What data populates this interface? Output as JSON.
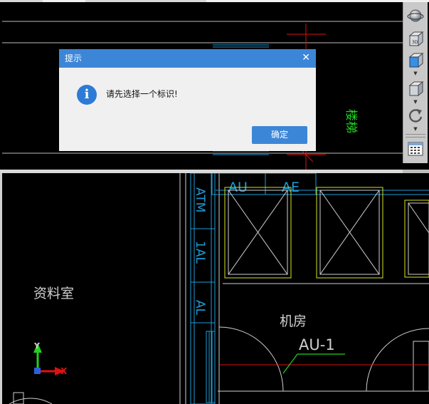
{
  "dialog": {
    "title": "提示",
    "close_glyph": "✕",
    "icon_glyph": "i",
    "message": "请先选择一个标识!",
    "ok_label": "确定"
  },
  "drawing": {
    "labels": {
      "top_vertical_text": "楼梯",
      "au": "AU",
      "ae": "AE",
      "atm": "ATM",
      "al1": "1AL",
      "al2": "AL",
      "data_room": "资料室",
      "machine_room": "机房",
      "au1": "AU-1"
    },
    "axis": {
      "x": "X",
      "y": "Y"
    }
  },
  "colors": {
    "dialog_blue": "#3c86d8",
    "cad_background": "#000000",
    "cyan_lines": "#1e9bd7",
    "yellow_lines": "#d7e31e",
    "white_lines": "#cfcfcf",
    "green_lines": "#22d022",
    "red_lines": "#e01010"
  },
  "toolbar": {
    "icons": [
      "orbit-icon",
      "view-3d-icon",
      "view-box-icon",
      "view-cube-icon",
      "rotate-icon",
      "grid-panel-icon"
    ]
  }
}
